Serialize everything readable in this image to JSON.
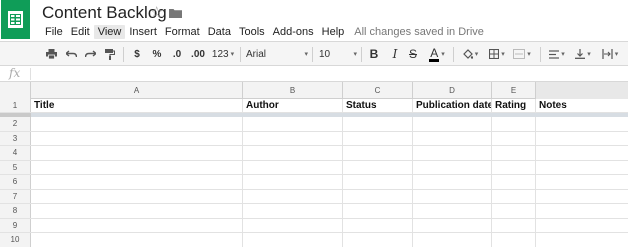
{
  "app": {
    "doc_title": "Content Backlog",
    "save_status": "All changes saved in Drive",
    "brand_color": "#0f9d58"
  },
  "menu": {
    "items": [
      "File",
      "Edit",
      "View",
      "Insert",
      "Format",
      "Data",
      "Tools",
      "Add-ons",
      "Help"
    ],
    "active": "View"
  },
  "toolbar": {
    "currency": "$",
    "percent": "%",
    "decrease_decimals": ".0",
    "increase_decimals": ".00",
    "more_formats": "123",
    "font": "Arial",
    "font_size": "10",
    "bold": "B",
    "italic": "I",
    "strikethrough": "S",
    "text_color": "A"
  },
  "formula_bar": {
    "label": "fx",
    "value": ""
  },
  "sheet": {
    "columns": [
      "A",
      "B",
      "C",
      "D",
      "E"
    ],
    "row_numbers": [
      "1",
      "2",
      "3",
      "4",
      "5",
      "6",
      "7",
      "8",
      "9",
      "10"
    ],
    "header_row": [
      "Title",
      "Author",
      "Status",
      "Publication date",
      "Rating",
      "Notes"
    ]
  }
}
